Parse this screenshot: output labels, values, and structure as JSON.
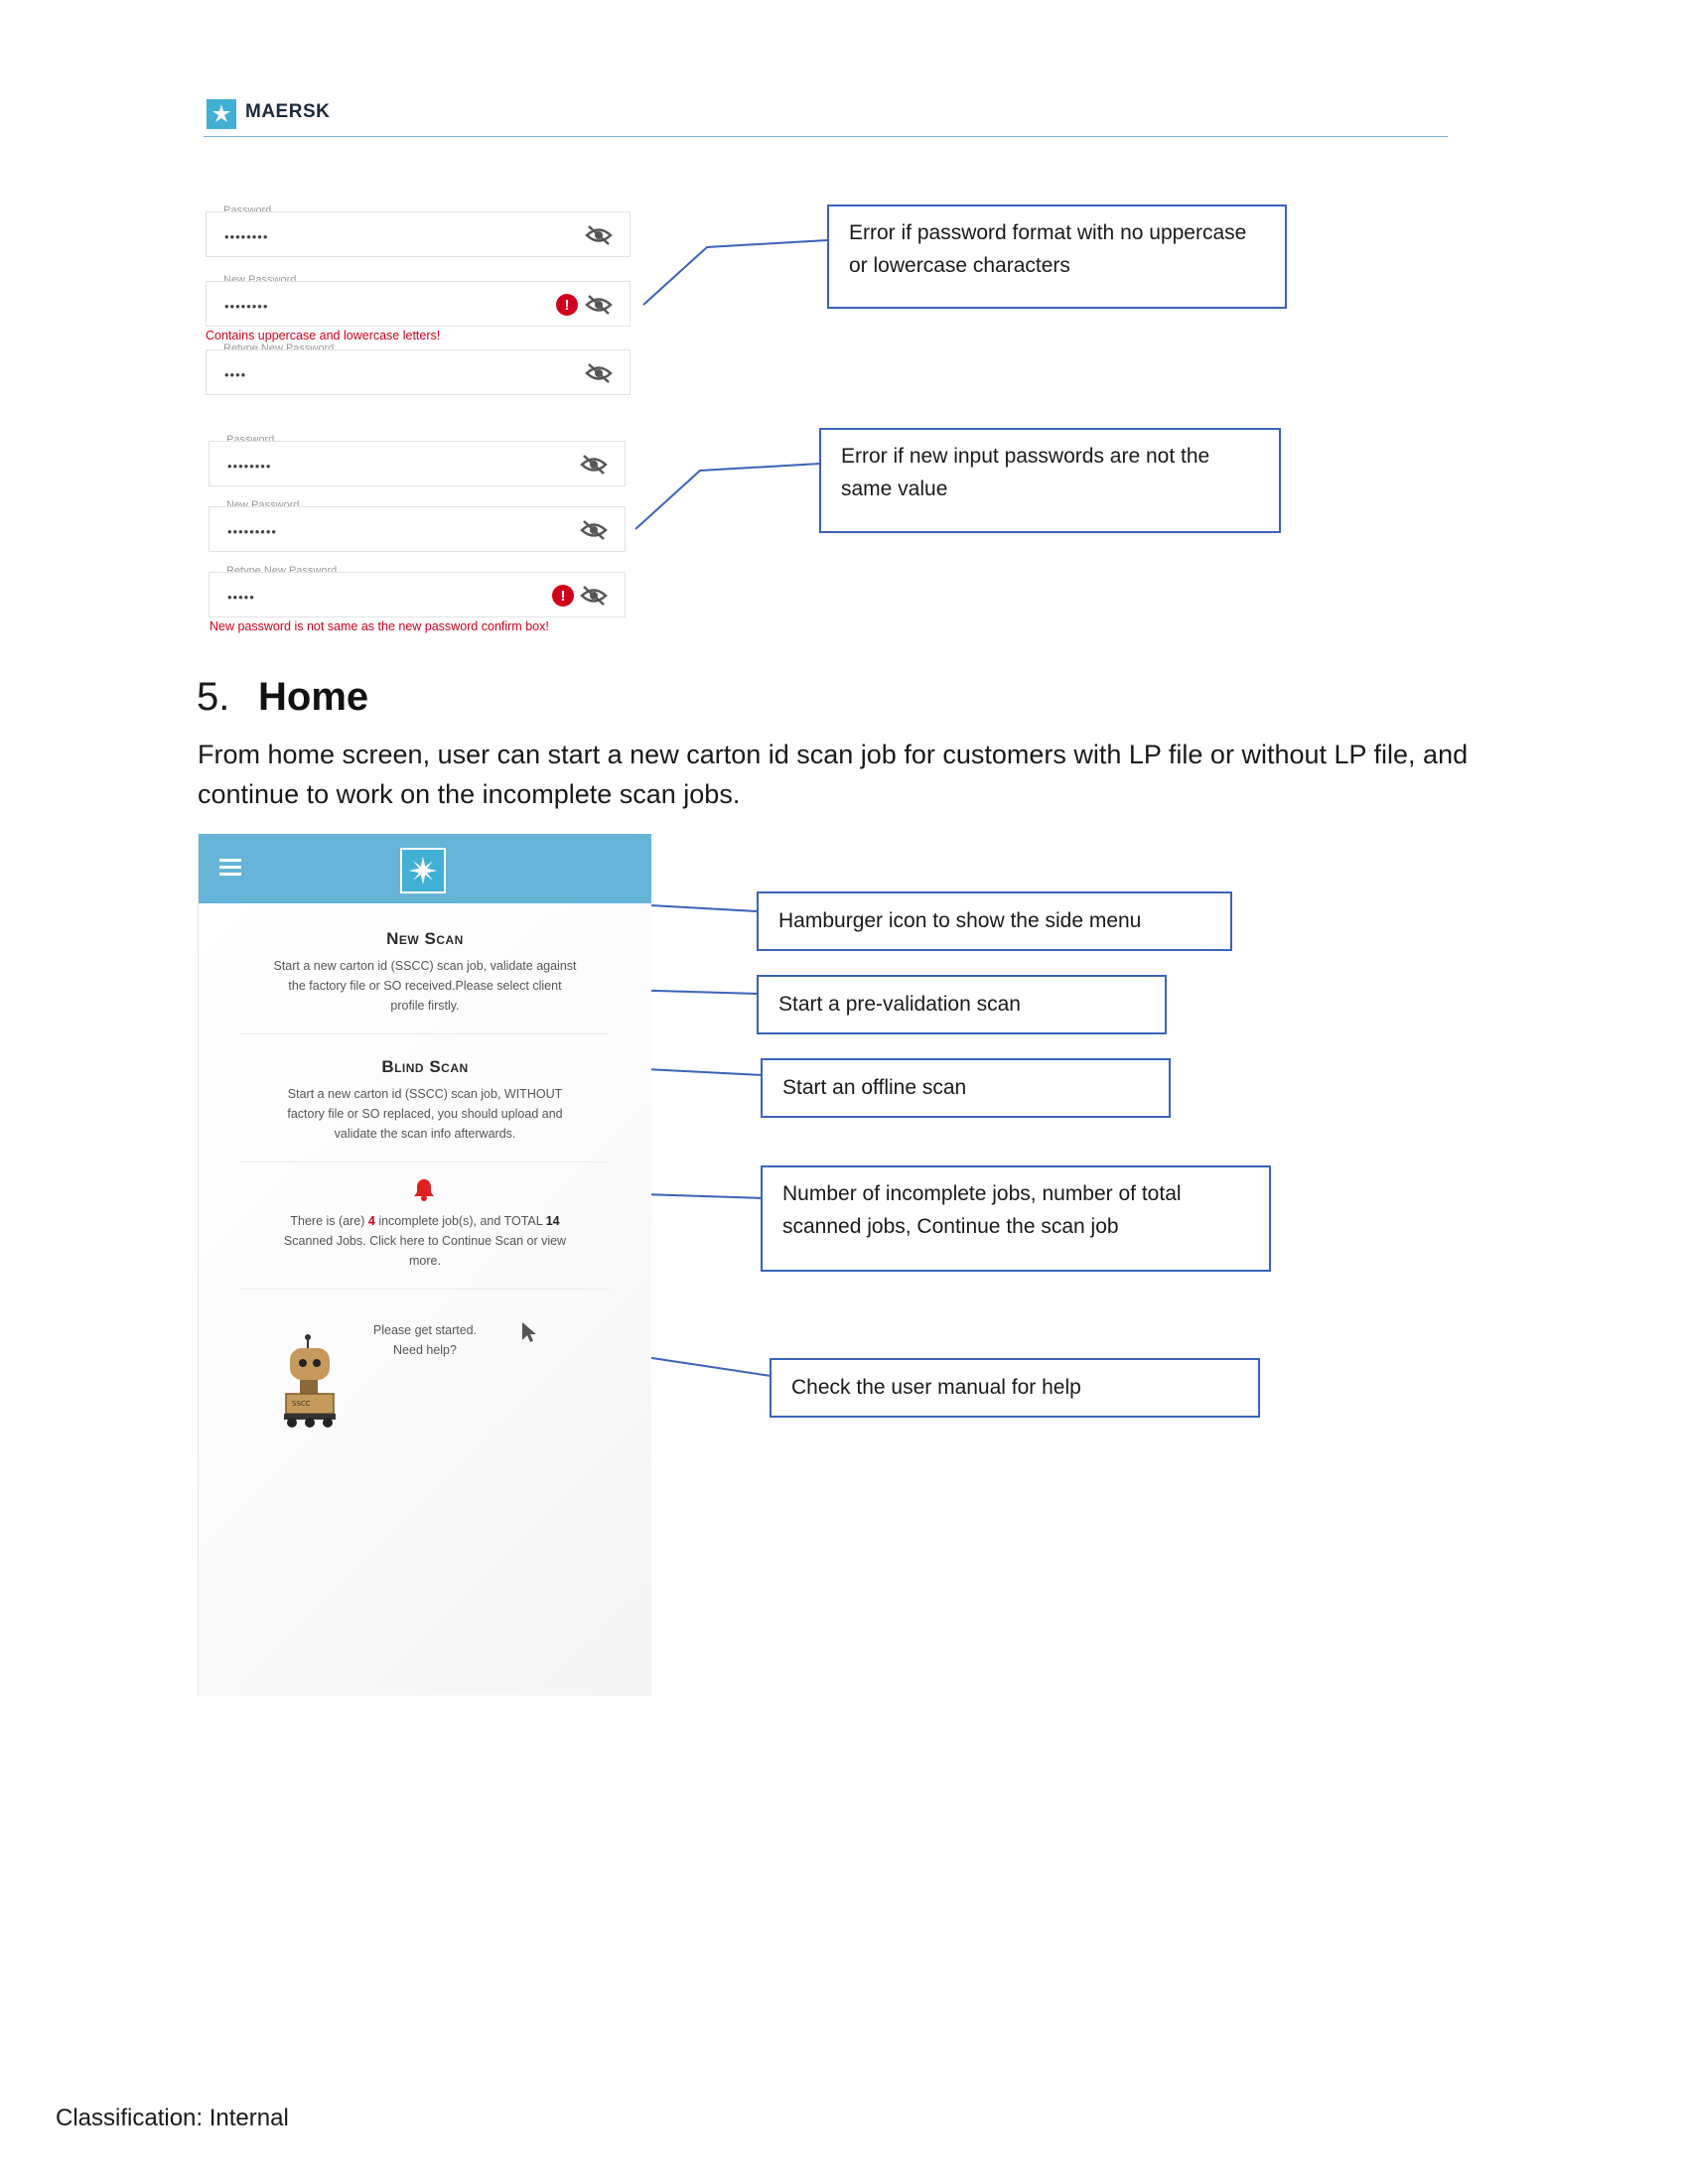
{
  "header": {
    "brand": "MAERSK"
  },
  "password_example_1": {
    "fields": [
      {
        "label": "Password",
        "value": "••••••••"
      },
      {
        "label": "New Password",
        "value": "••••••••"
      },
      {
        "label": "Retype New Password",
        "value": "••••"
      }
    ],
    "error": "Contains uppercase and lowercase letters!"
  },
  "password_example_2": {
    "fields": [
      {
        "label": "Password",
        "value": "••••••••"
      },
      {
        "label": "New Password",
        "value": "•••••••••"
      },
      {
        "label": "Retype New Password",
        "value": "•••••"
      }
    ],
    "error": "New password is not same as the new password confirm box!"
  },
  "callouts": {
    "pw_format": "Error if password format with no uppercase or lowercase characters",
    "pw_mismatch": "Error if new input passwords are not the same value",
    "hamburger": "Hamburger icon to show the side menu",
    "prevalidation": "Start a pre-validation scan",
    "offline": "Start an offline scan",
    "incomplete": "Number of incomplete jobs, number of total scanned jobs, Continue the scan job",
    "help": "Check the user manual for help"
  },
  "section": {
    "number": "5.",
    "title": "Home",
    "paragraph": "From home screen, user can start a new carton id scan job for customers with LP file or without LP file, and continue to work on the incomplete scan jobs."
  },
  "app": {
    "new_scan": {
      "title": "New Scan",
      "line1": "Start a new carton id (SSCC) scan job, validate against",
      "line2": "the factory file or SO received.Please select client",
      "line3": "profile firstly."
    },
    "blind_scan": {
      "title": "Blind Scan",
      "line1": "Start a new carton id (SSCC) scan job, WITHOUT",
      "line2": "factory file or SO replaced, you should upload and",
      "line3": "validate the scan info afterwards."
    },
    "jobs": {
      "prefix": "There is (are)",
      "incomplete_count": "4",
      "middle": "incomplete job(s), and TOTAL",
      "total_count": "14",
      "line2": "Scanned Jobs. Click here to Continue Scan or view",
      "line3": "more."
    },
    "help": {
      "line1": "Please get started.",
      "line2": "Need help?"
    }
  },
  "footer": {
    "classification": "Classification: Internal"
  },
  "colors": {
    "brand_blue": "#42b0d5",
    "app_bar": "#67b4d9",
    "callout_border": "#3a63b8",
    "error_red": "#d0021b"
  }
}
